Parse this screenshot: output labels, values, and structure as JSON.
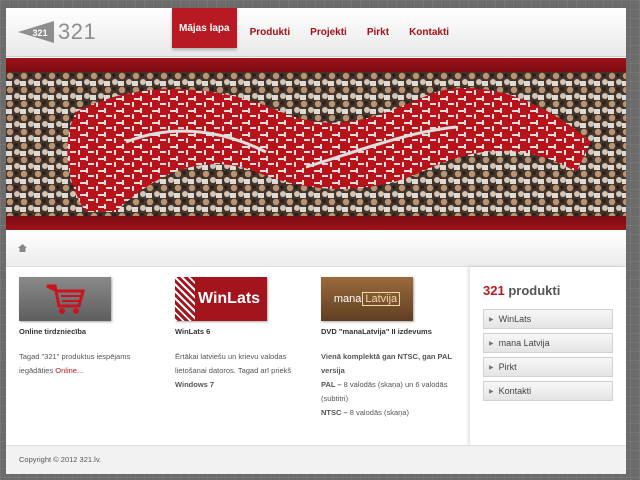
{
  "header": {
    "logo_text": "321",
    "nav": [
      "Mājas lapa",
      "Produkti",
      "Projekti",
      "Pirkt",
      "Kontakti"
    ],
    "active_index": 0
  },
  "breadcrumb": {
    "icon": "home-icon"
  },
  "columns": [
    {
      "image": "shopping-cart-image",
      "title": "Online tirdzniecība",
      "text_before": "Tagad \"321\" produktus iespējams iegādāties ",
      "link": "Online..."
    },
    {
      "image": "winlats-logo",
      "image_text": "WinLats",
      "title": "WinLats 6",
      "text_before": "Ērtākai latviešu un krievu valodas lietošanai datoros. Tagad arī priekš ",
      "text_bold": "Windows 7"
    },
    {
      "image": "manalatvija-logo",
      "image_text_a": "mana",
      "image_text_b": "Latvija",
      "title": "DVD \"manaLatvija\" II izdevums",
      "lead": "Vienā komplektā gan NTSC, gan PAL versija",
      "pal_label": "PAL –",
      "pal_text": " 8 valodās (skaņa) un 6 valodās (subtitri)",
      "ntsc_label": "NTSC –",
      "ntsc_text": " 8 valodās (skaņa)"
    }
  ],
  "sidebar": {
    "title_num": "321",
    "title_rest": " produkti",
    "items": [
      "WinLats",
      "mana Latvija",
      "Pirkt",
      "Kontakti"
    ]
  },
  "footer": {
    "copyright": "Copyright © 2012 321.lv."
  },
  "colors": {
    "accent": "#b71a22",
    "banner": "#8b0f14"
  }
}
